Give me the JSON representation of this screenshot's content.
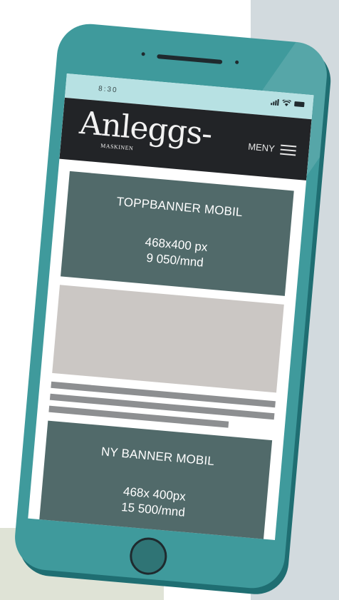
{
  "status_bar": {
    "time": "8:30"
  },
  "header": {
    "logo_main": "Anleggs-",
    "logo_sub": "MASKINEN",
    "menu_label": "MENY"
  },
  "banners": [
    {
      "title": "TOPPBANNER MOBIL",
      "size": "468x400 px",
      "price": "9 050/mnd"
    },
    {
      "title": "NY BANNER MOBIL",
      "size": "468x 400px",
      "price": "15 500/mnd"
    }
  ],
  "colors": {
    "phone_body": "#3f9a9c",
    "status_bar": "#b7e1e3",
    "app_bar": "#222427",
    "banner": "#516a6a",
    "image_placeholder": "#cbc7c4",
    "text_placeholder": "#8d8f91"
  },
  "icons": [
    "signal-icon",
    "wifi-icon",
    "battery-icon",
    "hamburger-menu-icon"
  ]
}
